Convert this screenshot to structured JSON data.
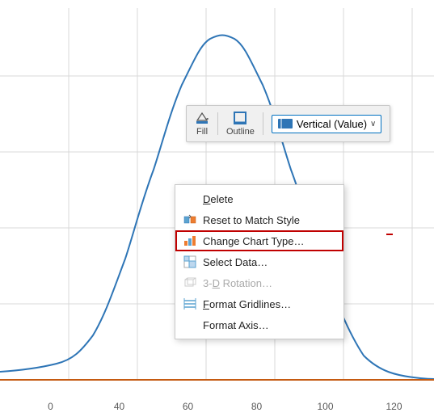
{
  "chart": {
    "xAxisLabels": [
      "0",
      "40",
      "60",
      "80",
      "100",
      "120"
    ],
    "gridColor": "#d0d0d0",
    "curveColor": "#2e75b6",
    "bottomLineColor": "#c55a11"
  },
  "toolbar": {
    "fillLabel": "Fill",
    "outlineLabel": "Outline",
    "dropdownLabel": "Vertical (Value)",
    "dropdownChevron": "∨"
  },
  "contextMenu": {
    "items": [
      {
        "id": "delete",
        "label": "Delete",
        "icon": "none",
        "underlineChar": "D",
        "disabled": false,
        "highlighted": false
      },
      {
        "id": "reset-match-style",
        "label": "Reset to Match Style",
        "icon": "reset",
        "disabled": false,
        "highlighted": false
      },
      {
        "id": "change-chart-type",
        "label": "Change Chart Type…",
        "icon": "chart",
        "disabled": false,
        "highlighted": true
      },
      {
        "id": "select-data",
        "label": "Select Data…",
        "icon": "select-data",
        "disabled": false,
        "highlighted": false
      },
      {
        "id": "3d-rotation",
        "label": "3-D Rotation…",
        "icon": "3d",
        "disabled": true,
        "highlighted": false
      },
      {
        "id": "format-gridlines",
        "label": "Format Gridlines…",
        "icon": "gridlines",
        "disabled": false,
        "highlighted": false
      },
      {
        "id": "format-axis",
        "label": "Format Axis…",
        "icon": "none",
        "disabled": false,
        "highlighted": false
      }
    ]
  }
}
